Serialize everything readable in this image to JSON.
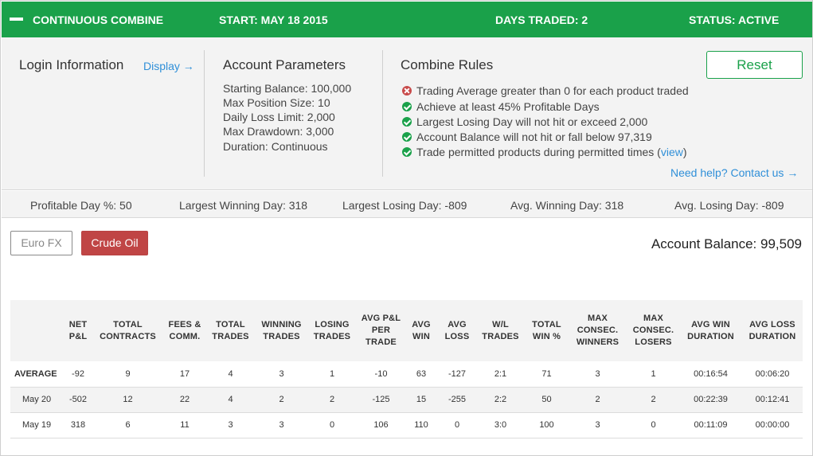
{
  "header": {
    "title": "CONTINUOUS COMBINE",
    "start": "START: MAY 18 2015",
    "days_traded": "DAYS TRADED: 2",
    "status": "STATUS: ACTIVE"
  },
  "login": {
    "title": "Login Information",
    "display_link": "Display →"
  },
  "account_params": {
    "title": "Account Parameters",
    "items": [
      "Starting Balance: 100,000",
      "Max Position Size: 10",
      "Daily Loss Limit: 2,000",
      "Max Drawdown: 3,000",
      "Duration: Continuous"
    ]
  },
  "combine_rules": {
    "title": "Combine Rules",
    "reset_label": "Reset",
    "rules": [
      {
        "status": "fail",
        "text": "Trading Average greater than 0 for each product traded"
      },
      {
        "status": "pass",
        "text": "Achieve at least 45% Profitable Days"
      },
      {
        "status": "pass",
        "text": "Largest Losing Day will not hit or exceed 2,000"
      },
      {
        "status": "pass",
        "text": "Account Balance will not hit or fall below 97,319"
      },
      {
        "status": "pass",
        "text": "Trade permitted products during permitted times (",
        "link": "view",
        "suffix": ")"
      }
    ],
    "help_link": "Need help? Contact us →"
  },
  "stats": {
    "profitable_day_pct": "Profitable Day %: 50",
    "largest_winning_day": "Largest Winning Day: 318",
    "largest_losing_day": "Largest Losing Day: -809",
    "avg_winning_day": "Avg. Winning Day: 318",
    "avg_losing_day": "Avg. Losing Day: -809"
  },
  "products": {
    "euro_fx": "Euro FX",
    "crude_oil": "Crude Oil",
    "account_balance": "Account Balance: 99,509"
  },
  "table": {
    "headers": [
      "",
      "NET P&L",
      "TOTAL CONTRACTS",
      "FEES & COMM.",
      "TOTAL TRADES",
      "WINNING TRADES",
      "LOSING TRADES",
      "AVG P&L PER TRADE",
      "AVG WIN",
      "AVG LOSS",
      "W/L TRADES",
      "TOTAL WIN %",
      "MAX CONSEC. WINNERS",
      "MAX CONSEC. LOSERS",
      "AVG WIN DURATION",
      "AVG LOSS DURATION"
    ],
    "rows": [
      [
        "AVERAGE",
        "-92",
        "9",
        "17",
        "4",
        "3",
        "1",
        "-10",
        "63",
        "-127",
        "2:1",
        "71",
        "3",
        "1",
        "00:16:54",
        "00:06:20"
      ],
      [
        "May 20",
        "-502",
        "12",
        "22",
        "4",
        "2",
        "2",
        "-125",
        "15",
        "-255",
        "2:2",
        "50",
        "2",
        "2",
        "00:22:39",
        "00:12:41"
      ],
      [
        "May 19",
        "318",
        "6",
        "11",
        "3",
        "3",
        "0",
        "106",
        "110",
        "0",
        "3:0",
        "100",
        "3",
        "0",
        "00:11:09",
        "00:00:00"
      ]
    ]
  }
}
